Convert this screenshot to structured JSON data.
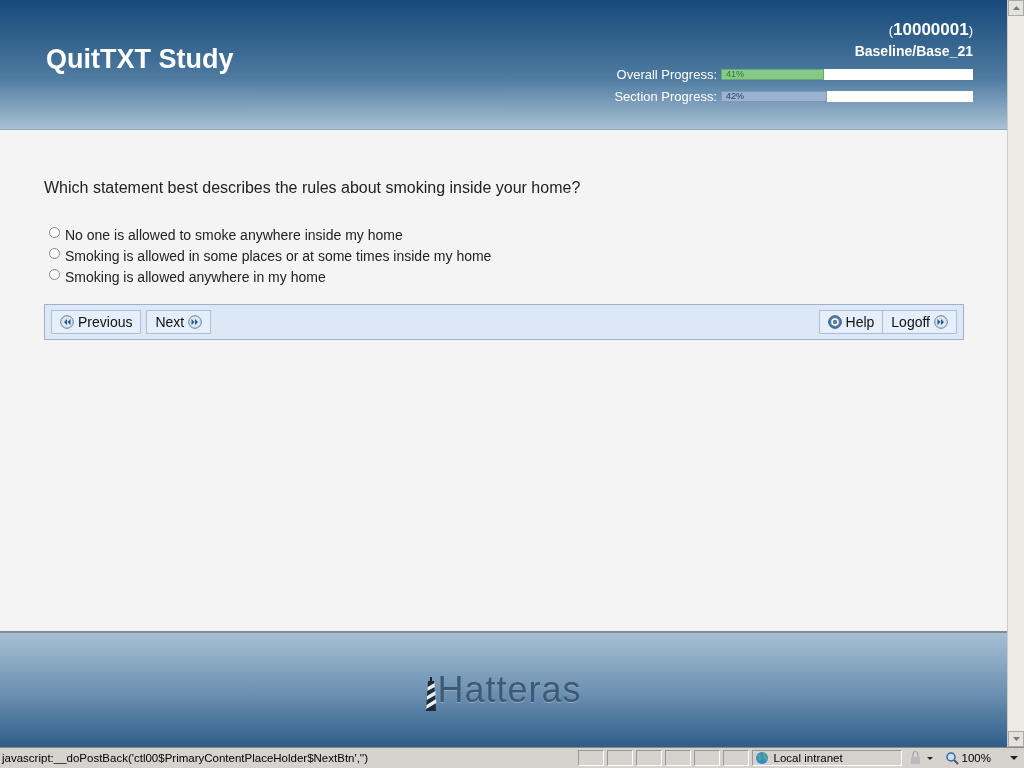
{
  "header": {
    "title": "QuitTXT Study",
    "participant_open": "(",
    "participant_id": "10000001",
    "participant_close": ")",
    "survey_item": "Baseline/Base_21",
    "progress": [
      {
        "label": "Overall Progress:",
        "level": 0.41,
        "reading": "41%",
        "kind": "overall"
      },
      {
        "label": "Section Progress:",
        "level": 0.42,
        "reading": "42%",
        "kind": "section"
      }
    ]
  },
  "question": "Which statement best describes the rules about smoking inside your home?",
  "options": [
    {
      "label": "No one is allowed to smoke anywhere inside my home",
      "selected": false
    },
    {
      "label": "Smoking is allowed in some places or at some times inside my home",
      "selected": false
    },
    {
      "label": "Smoking is allowed anywhere in my home",
      "selected": false
    }
  ],
  "nav_left": [
    {
      "label": "Previous",
      "kind": "back"
    },
    {
      "label": "Next",
      "kind": "forward"
    }
  ],
  "nav_right": [
    {
      "label": "Help",
      "kind": "help"
    },
    {
      "label": "Logoff",
      "kind": "forward"
    }
  ],
  "footer": {
    "logo": "Hatteras"
  },
  "status_bar": {
    "message": "javascript:__doPostBack('ctl00$PrimaryContentPlaceHolder$NextBtn','')",
    "zone": "Local intranet",
    "zoom": "100%"
  }
}
